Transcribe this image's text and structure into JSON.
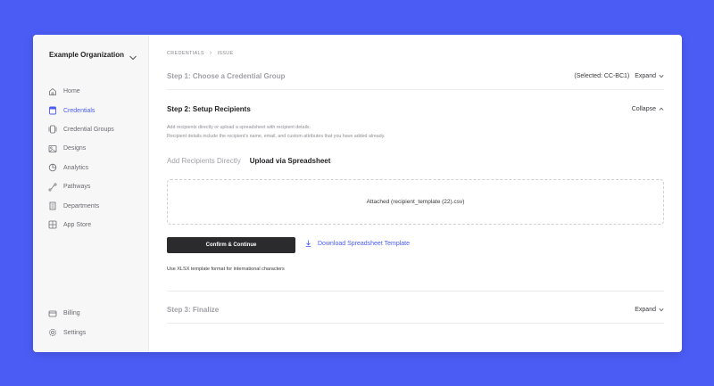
{
  "org": {
    "name": "Example Organization"
  },
  "sidebar": {
    "items": [
      {
        "label": "Home",
        "icon": "home-icon"
      },
      {
        "label": "Credentials",
        "icon": "credentials-icon",
        "active": true
      },
      {
        "label": "Credential Groups",
        "icon": "credential-groups-icon"
      },
      {
        "label": "Designs",
        "icon": "designs-icon"
      },
      {
        "label": "Analytics",
        "icon": "analytics-icon"
      },
      {
        "label": "Pathways",
        "icon": "pathways-icon"
      },
      {
        "label": "Departments",
        "icon": "departments-icon"
      },
      {
        "label": "App Store",
        "icon": "app-store-icon"
      }
    ],
    "bottom": [
      {
        "label": "Billing",
        "icon": "billing-icon"
      },
      {
        "label": "Settings",
        "icon": "settings-icon"
      }
    ]
  },
  "breadcrumb": {
    "items": [
      "CREDENTIALS",
      "ISSUE"
    ]
  },
  "step1": {
    "title": "Step 1: Choose a Credential Group",
    "selected": "(Selected: CC-BC1)",
    "toggle_label": "Expand"
  },
  "step2": {
    "title": "Step 2: Setup Recipients",
    "toggle_label": "Collapse",
    "helper_line1": "Add recipients directly or upload a spreadsheet with recipient details.",
    "helper_line2": "Recipient details include the recipient's name, email, and custom attributes that you have added already.",
    "tabs": [
      "Add Recipients Directly",
      "Upload via Spreadsheet"
    ],
    "dropzone_text": "Attached (recipient_template (22).csv)",
    "confirm_label": "Confirm & Continue",
    "download_label": "Download Spreadsheet Template",
    "note": "Use XLSX template format for international characters"
  },
  "step3": {
    "title": "Step 3: Finalize",
    "toggle_label": "Expand"
  },
  "colors": {
    "accent": "#4b5cf5",
    "background": "#4b5cf5",
    "button": "#2b2b2e"
  }
}
